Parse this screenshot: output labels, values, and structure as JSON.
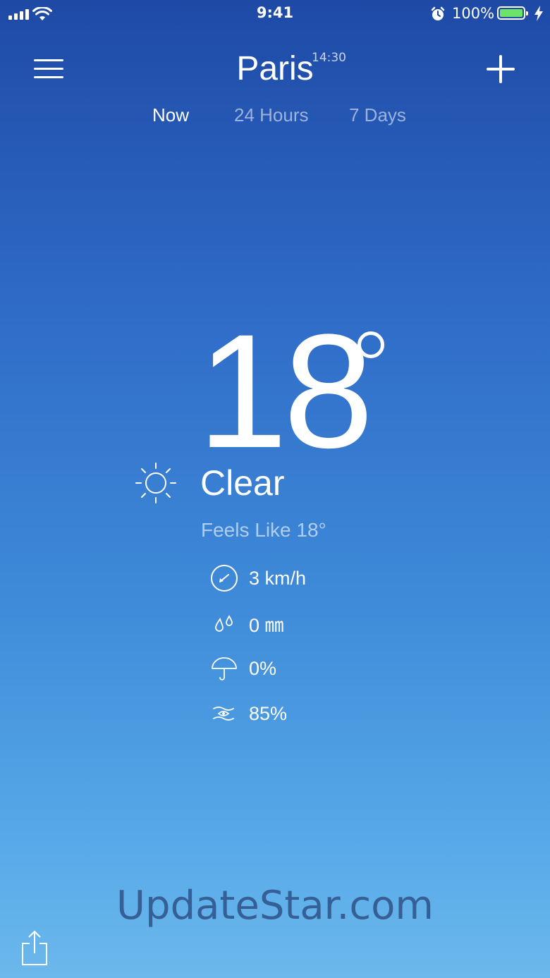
{
  "status_bar": {
    "time": "9:41",
    "battery_percent": "100%",
    "battery_level": 1.0,
    "battery_color": "#6ee36a",
    "icons": [
      "signal-icon",
      "wifi-icon",
      "alarm-icon",
      "battery-icon",
      "charging-bolt-icon"
    ]
  },
  "header": {
    "city": "Paris",
    "local_time": "14:30",
    "menu_icon": "hamburger-menu-icon",
    "add_icon": "plus-icon"
  },
  "tabs": [
    {
      "label": "Now",
      "active": true
    },
    {
      "label": "24 Hours",
      "active": false
    },
    {
      "label": "7 Days",
      "active": false
    }
  ],
  "current": {
    "temperature": "18",
    "degree_symbol": "°",
    "condition": "Clear",
    "condition_icon": "sun-icon",
    "feels_like": "Feels Like 18°"
  },
  "details": [
    {
      "icon": "wind-compass-icon",
      "value": "3 km/h"
    },
    {
      "icon": "precipitation-drops-icon",
      "value": "0 ㎜"
    },
    {
      "icon": "umbrella-icon",
      "value": "0%"
    },
    {
      "icon": "humidity-icon",
      "value": "85%"
    }
  ],
  "watermark": "UpdateStar.com",
  "footer": {
    "share_icon": "share-icon"
  }
}
